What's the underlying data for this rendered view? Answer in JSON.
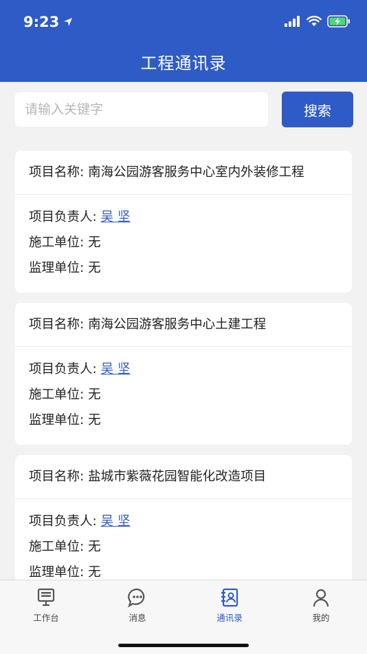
{
  "status": {
    "time": "9:23",
    "icons": [
      "location-arrow-icon",
      "signal-icon",
      "wifi-icon",
      "battery-charging-icon"
    ]
  },
  "header": {
    "title": "工程通讯录"
  },
  "search": {
    "placeholder": "请输入关键字",
    "value": "",
    "button_label": "搜索"
  },
  "projects": [
    {
      "name_label": "项目名称:",
      "name": "南海公园游客服务中心室内外装修工程",
      "lead_label": "项目负责人:",
      "lead": "吴 坚",
      "contractor_label": "施工单位:",
      "contractor": "无",
      "supervisor_label": "监理单位:",
      "supervisor": "无"
    },
    {
      "name_label": "项目名称:",
      "name": "南海公园游客服务中心土建工程",
      "lead_label": "项目负责人:",
      "lead": "吴 坚",
      "contractor_label": "施工单位:",
      "contractor": "无",
      "supervisor_label": "监理单位:",
      "supervisor": "无"
    },
    {
      "name_label": "项目名称:",
      "name": "盐城市紫薇花园智能化改造项目",
      "lead_label": "项目负责人:",
      "lead": "吴 坚",
      "contractor_label": "施工单位:",
      "contractor": "无",
      "supervisor_label": "监理单位:",
      "supervisor": "无"
    }
  ],
  "tabbar": {
    "tabs": [
      {
        "label": "工作台",
        "icon": "monitor-icon",
        "active": false
      },
      {
        "label": "消息",
        "icon": "message-bubble-icon",
        "active": false
      },
      {
        "label": "通讯录",
        "icon": "contacts-icon",
        "active": true
      },
      {
        "label": "我的",
        "icon": "person-icon",
        "active": false
      }
    ]
  },
  "colors": {
    "primary": "#2e5bc5",
    "background": "#f2f2f2",
    "battery": "#4cd964"
  }
}
